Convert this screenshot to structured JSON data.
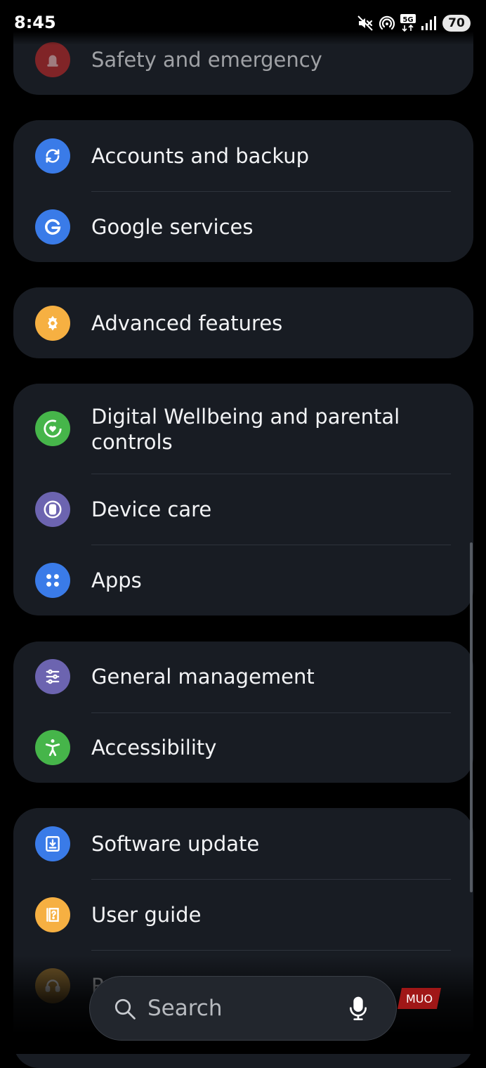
{
  "status": {
    "time": "8:45",
    "battery": "70",
    "network": "5G"
  },
  "cards": [
    {
      "items": [
        {
          "label": "Safety and emergency",
          "icon": "siren-icon",
          "color": "#c02b2b"
        }
      ]
    },
    {
      "items": [
        {
          "label": "Accounts and backup",
          "icon": "sync-icon",
          "color": "#3a7be8"
        },
        {
          "label": "Google services",
          "icon": "google-g-icon",
          "color": "#3a7be8"
        }
      ]
    },
    {
      "items": [
        {
          "label": "Advanced features",
          "icon": "puzzle-gear-icon",
          "color": "#f6b042"
        }
      ]
    },
    {
      "items": [
        {
          "label": "Digital Wellbeing and parental controls",
          "icon": "heart-ring-icon",
          "color": "#46b54a"
        },
        {
          "label": "Device care",
          "icon": "device-care-icon",
          "color": "#6c64b0"
        },
        {
          "label": "Apps",
          "icon": "apps-grid-icon",
          "color": "#3a7be8"
        }
      ]
    },
    {
      "items": [
        {
          "label": "General management",
          "icon": "sliders-icon",
          "color": "#6c64b0"
        },
        {
          "label": "Accessibility",
          "icon": "accessibility-icon",
          "color": "#46b54a"
        }
      ]
    },
    {
      "items": [
        {
          "label": "Software update",
          "icon": "download-icon",
          "color": "#3a7be8"
        },
        {
          "label": "User guide",
          "icon": "question-book-icon",
          "color": "#f6b042"
        },
        {
          "label": "R",
          "icon": "headset-icon",
          "color": "#f6b042"
        }
      ]
    }
  ],
  "search": {
    "placeholder": "Search"
  },
  "watermark": "MUO"
}
